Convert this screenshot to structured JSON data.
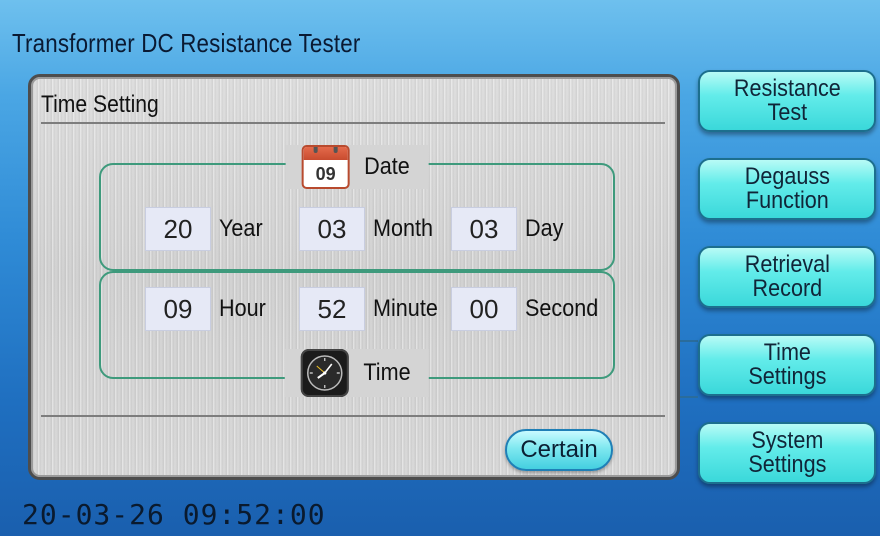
{
  "app": {
    "title": "Transformer DC Resistance Tester"
  },
  "panel": {
    "title": "Time Setting",
    "date_group": {
      "legend": "Date",
      "icon": "calendar-icon",
      "calendar_day": "09",
      "year": {
        "value": "20",
        "label": "Year"
      },
      "month": {
        "value": "03",
        "label": "Month"
      },
      "day": {
        "value": "03",
        "label": "Day"
      }
    },
    "time_group": {
      "legend": "Time",
      "icon": "clock-icon",
      "hour": {
        "value": "09",
        "label": "Hour"
      },
      "minute": {
        "value": "52",
        "label": "Minute"
      },
      "second": {
        "value": "00",
        "label": "Second"
      }
    },
    "certain_label": "Certain"
  },
  "sidebar": {
    "items": [
      {
        "label": "Resistance\nTest"
      },
      {
        "label": "Degauss\nFunction"
      },
      {
        "label": "Retrieval\nRecord"
      },
      {
        "label": "Time\nSettings"
      },
      {
        "label": "System\nSettings"
      }
    ]
  },
  "status": {
    "datetime": "20-03-26 09:52:00"
  },
  "colors": {
    "accent_button": "#63ecea",
    "group_border": "#3e9a7c",
    "background_top": "#6ec0ee",
    "background_bottom": "#1a5fae"
  }
}
